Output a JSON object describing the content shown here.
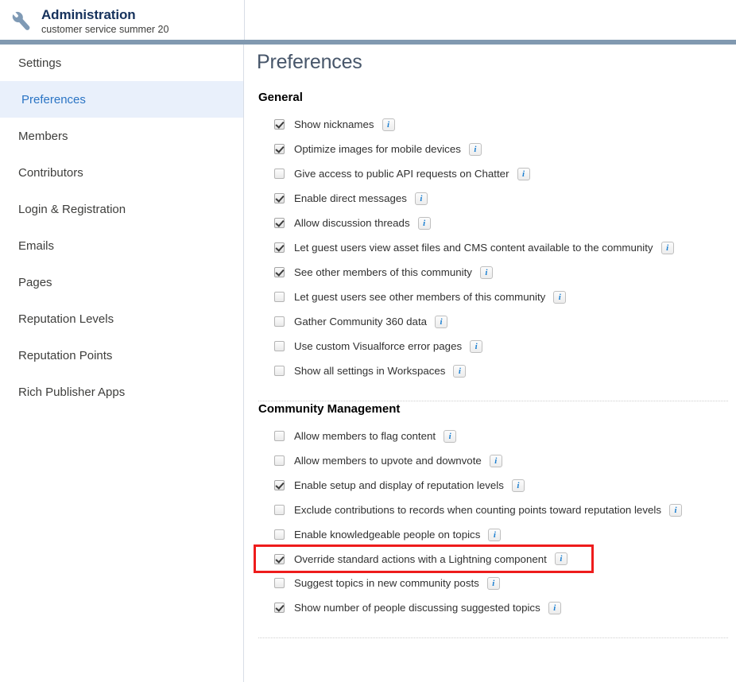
{
  "header": {
    "icon": "wrench-icon",
    "title": "Administration",
    "subtitle": "customer service summer 20"
  },
  "sidebar": {
    "items": [
      {
        "label": "Settings",
        "selected": false
      },
      {
        "label": "Preferences",
        "selected": true
      },
      {
        "label": "Members",
        "selected": false
      },
      {
        "label": "Contributors",
        "selected": false
      },
      {
        "label": "Login & Registration",
        "selected": false
      },
      {
        "label": "Emails",
        "selected": false
      },
      {
        "label": "Pages",
        "selected": false
      },
      {
        "label": "Reputation Levels",
        "selected": false
      },
      {
        "label": "Reputation Points",
        "selected": false
      },
      {
        "label": "Rich Publisher Apps",
        "selected": false
      }
    ]
  },
  "main": {
    "page_title": "Preferences",
    "info_glyph": "i",
    "sections": [
      {
        "title": "General",
        "items": [
          {
            "label": "Show nicknames",
            "checked": true,
            "info": true,
            "highlight": false
          },
          {
            "label": "Optimize images for mobile devices",
            "checked": true,
            "info": true,
            "highlight": false
          },
          {
            "label": "Give access to public API requests on Chatter",
            "checked": false,
            "info": true,
            "highlight": false
          },
          {
            "label": "Enable direct messages",
            "checked": true,
            "info": true,
            "highlight": false
          },
          {
            "label": "Allow discussion threads",
            "checked": true,
            "info": true,
            "highlight": false
          },
          {
            "label": "Let guest users view asset files and CMS content available to the community",
            "checked": true,
            "info": true,
            "highlight": false
          },
          {
            "label": "See other members of this community",
            "checked": true,
            "info": true,
            "highlight": false
          },
          {
            "label": "Let guest users see other members of this community",
            "checked": false,
            "info": true,
            "highlight": false
          },
          {
            "label": "Gather Community 360 data",
            "checked": false,
            "info": true,
            "highlight": false
          },
          {
            "label": "Use custom Visualforce error pages",
            "checked": false,
            "info": true,
            "highlight": false
          },
          {
            "label": "Show all settings in Workspaces",
            "checked": false,
            "info": true,
            "highlight": false
          }
        ]
      },
      {
        "title": "Community Management",
        "items": [
          {
            "label": "Allow members to flag content",
            "checked": false,
            "info": true,
            "highlight": false
          },
          {
            "label": "Allow members to upvote and downvote",
            "checked": false,
            "info": true,
            "highlight": false
          },
          {
            "label": "Enable setup and display of reputation levels",
            "checked": true,
            "info": true,
            "highlight": false
          },
          {
            "label": "Exclude contributions to records when counting points toward reputation levels",
            "checked": false,
            "info": true,
            "highlight": false
          },
          {
            "label": "Enable knowledgeable people on topics",
            "checked": false,
            "info": true,
            "highlight": false
          },
          {
            "label": "Override standard actions with a Lightning component",
            "checked": true,
            "info": true,
            "highlight": true
          },
          {
            "label": "Suggest topics in new community posts",
            "checked": false,
            "info": true,
            "highlight": false
          },
          {
            "label": "Show number of people discussing suggested topics",
            "checked": true,
            "info": true,
            "highlight": false
          }
        ]
      }
    ]
  },
  "colors": {
    "header_rule": "#8199b0",
    "selected_nav_bg": "#e9f0fb",
    "selected_nav_text": "#2a74c4",
    "title_text": "#47566a",
    "highlight_outline": "#ee1c1c",
    "info_blue": "#1b7fd1"
  }
}
